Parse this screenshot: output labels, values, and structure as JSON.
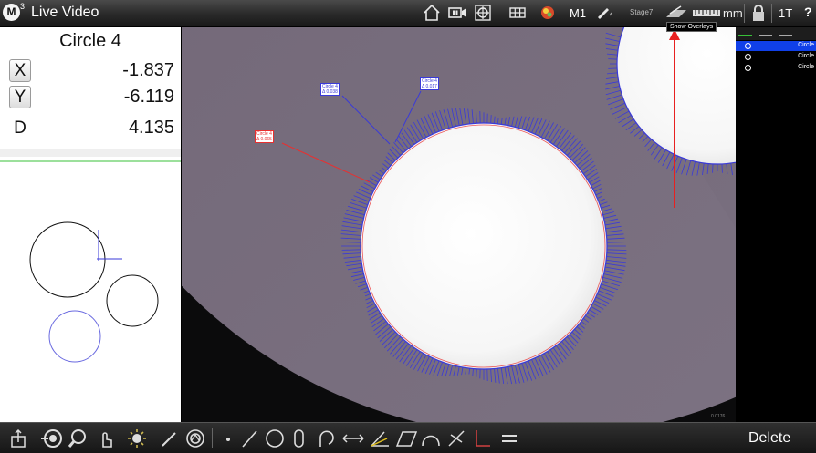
{
  "app": {
    "logo_letter": "M",
    "logo_sup": "3",
    "title": "Live Video"
  },
  "toolbar": {
    "m1": "M1",
    "stage": "Stage7",
    "units": "mm",
    "tooltip": "Show Overlays",
    "tool": "1T",
    "help": "?"
  },
  "result": {
    "feature": "Circle 4",
    "rows": [
      {
        "axis": "X",
        "value": "-1.837",
        "button": true
      },
      {
        "axis": "Y",
        "value": "-6.119",
        "button": true
      },
      {
        "axis": "D",
        "value": "4.135",
        "button": false
      }
    ]
  },
  "overlays": [
    {
      "title": "Circle 4",
      "value": "0.038",
      "color": "#3a3ad8"
    },
    {
      "title": "Circle 4",
      "value": "0.017",
      "color": "#3a3ad8"
    },
    {
      "title": "Circle 4",
      "value": "0.065",
      "color": "#e83030"
    }
  ],
  "video_stamp": "0.0176",
  "feature_list": {
    "items": [
      {
        "label": "Circle",
        "selected": true
      },
      {
        "label": "Circle",
        "selected": false
      },
      {
        "label": "Circle",
        "selected": false
      }
    ]
  },
  "bottom": {
    "delete_label": "Delete"
  },
  "colors": {
    "selection": "#1040e8",
    "measured": "#3a3ad8",
    "nominal": "#e83030",
    "accent_green": "#38c038"
  },
  "icons": {
    "top": [
      "home-icon",
      "video-record-icon",
      "crosshair-icon",
      "grid-icon",
      "light-icon",
      "probe-icon",
      "overlay-icon",
      "scale-ruler-icon",
      "lock-icon"
    ],
    "bottom": [
      "part-icon",
      "target-icon",
      "magnifier-icon",
      "hand-touch-icon",
      "light-sun-icon",
      "pen-icon",
      "edge-detect-icon",
      "point-tool-icon",
      "line-tool-icon",
      "circle-tool-icon",
      "slot-tool-icon",
      "arc-tool-icon",
      "distance-tool-icon",
      "angle-tool-icon",
      "plane-tool-icon",
      "curve-tool-icon",
      "intersect-tool-icon",
      "perpendicular-tool-icon",
      "parallel-tool-icon"
    ]
  }
}
